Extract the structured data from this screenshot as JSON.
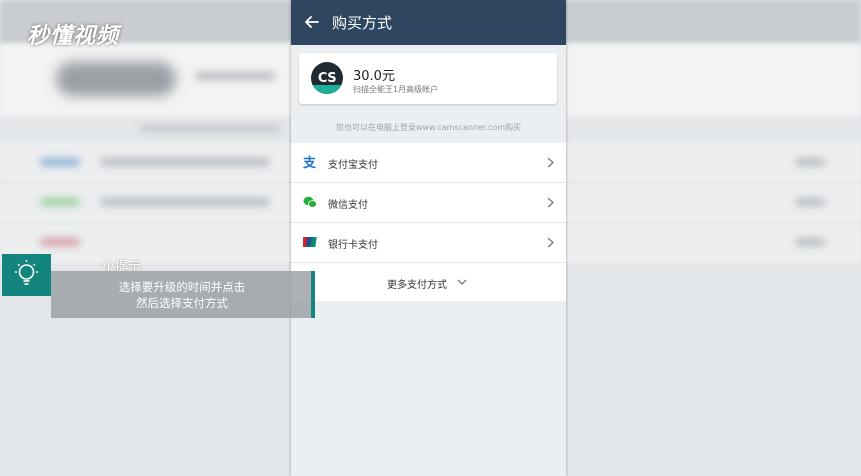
{
  "watermark": {
    "logo_text": "秒懂视频"
  },
  "header": {
    "title": "购买方式"
  },
  "product": {
    "logo_text": "CS",
    "price": "30.0元",
    "description": "扫描全能王1月高级帐户"
  },
  "hint": "您也可以在电脑上登录www.camscanner.com购买",
  "payment_methods": [
    {
      "label": "支付宝支付",
      "icon": "alipay-icon",
      "color": "#1a74c9"
    },
    {
      "label": "微信支付",
      "icon": "wechat-icon",
      "color": "#2aae3b"
    },
    {
      "label": "银行卡支付",
      "icon": "unionpay-icon",
      "color": "#d5202a"
    }
  ],
  "more": {
    "label": "更多支付方式"
  },
  "tip": {
    "title": "小提示",
    "line1": "选择要升级的时间并点击",
    "line2": "然后选择支付方式"
  },
  "colors": {
    "appbar": "#2e4660",
    "accent": "#14857c"
  }
}
